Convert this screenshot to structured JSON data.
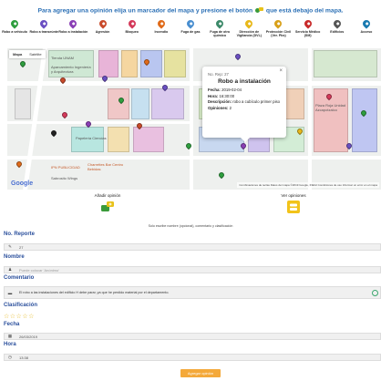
{
  "banner": {
    "text_before": "Para agregar una opinión elija un marcador del mapa y presione el botón",
    "text_after": "que está debajo del mapa."
  },
  "legend": [
    {
      "label": "Robo a vehículo",
      "color": "#2e9e3e"
    },
    {
      "label": "Robo a transeúnte",
      "color": "#6a4fc2"
    },
    {
      "label": "Robo a instalación",
      "color": "#8a3fb5"
    },
    {
      "label": "Agresión",
      "color": "#c94a2a"
    },
    {
      "label": "Bloqueo",
      "color": "#d43a5a"
    },
    {
      "label": "Incendio",
      "color": "#e06b1a"
    },
    {
      "label": "Fuga de gas",
      "color": "#4a8fd0"
    },
    {
      "label": "Fuga de otro químico",
      "color": "#3d8a6a"
    },
    {
      "label": "Dirección de Vigilancia (DVL)",
      "color": "#e8b81a"
    },
    {
      "label": "Protección Civil (Ver. Pbs)",
      "color": "#d8a01a"
    },
    {
      "label": "Servicio Médico (SM)",
      "color": "#c82a2a"
    },
    {
      "label": "Edificios",
      "color": "#555555"
    },
    {
      "label": "Acceso",
      "color": "#1a7ab0"
    }
  ],
  "map": {
    "controls": [
      "Mapa",
      "Satélite"
    ],
    "labels": [
      {
        "text": "Tienda UNAM"
      },
      {
        "text": "Aparcamiento Ingeniería y Arquitectura"
      },
      {
        "text": "Papelería Ciencias"
      },
      {
        "text": "IPN PUBLICIDAD"
      },
      {
        "text": "Charrettes Bar Centro Bebidas"
      },
      {
        "text": "Sabrosito Wings"
      },
      {
        "text": "Plaza Roja Unidad Azcapotzalco"
      }
    ],
    "google": "Google",
    "footer": "Combinaciones de teclas   Datos del mapa ©2019 Google, INEGI   Condiciones de uso   Informar un error en el mapa"
  },
  "popup": {
    "id_line": "No. Rep: 27",
    "title": "Robo a instalación",
    "fecha_label": "Fecha:",
    "fecha": "2019-02-04",
    "hora_label": "Hora:",
    "hora": "16:30:00",
    "descripcion_label": "Descripción:",
    "descripcion": "robo a cubículo primer piso",
    "opiniones_label": "Opiniones:",
    "opiniones": "2",
    "close": "×"
  },
  "actions": {
    "add_label": "Añadir opinión",
    "view_label": "Ver opiniones"
  },
  "form": {
    "subtitle": "Solo escribe nombre (opcional), comentario y clasificación",
    "no_reporte_label": "No. Reporte",
    "no_reporte_value": "27",
    "nombre_label": "Nombre",
    "nombre_placeholder": "Puede colocar 'Anónimo'",
    "comentario_label": "Comentario",
    "comentario_value": "El robo a las instalaciones del edificio H debe parar, ya que he perdido material por el departamento.",
    "clasificacion_label": "Clasificación",
    "stars": "☆☆☆☆☆",
    "rating": 0,
    "fecha_label": "Fecha",
    "fecha_value": "26/03/2019",
    "hora_label": "Hora",
    "hora_value": "13:38",
    "submit_label": "Agregar opinión"
  }
}
